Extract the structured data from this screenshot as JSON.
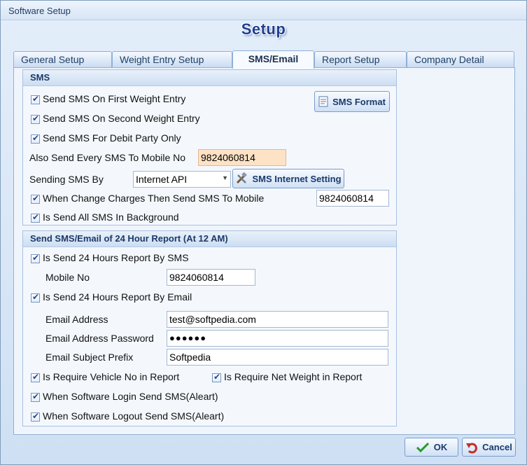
{
  "window": {
    "title": "Software Setup"
  },
  "heading": "Setup",
  "tabs": [
    {
      "label": "General Setup"
    },
    {
      "label": "Weight Entry Setup"
    },
    {
      "label": "SMS/Email"
    },
    {
      "label": "Report Setup"
    },
    {
      "label": "Company Detail"
    }
  ],
  "sms": {
    "header": "SMS",
    "first_entry": "Send SMS On First Weight Entry",
    "second_entry": "Send SMS On Second Weight Entry",
    "debit_party": "Send SMS For Debit Party Only",
    "sms_format_label": "SMS Format",
    "also_send_label": "Also Send Every SMS To Mobile No",
    "also_send_value": "9824060814",
    "sending_by_label": "Sending SMS By",
    "sending_by_value": "Internet API",
    "internet_setting_label": "SMS Internet Setting",
    "change_charges_label": "When Change Charges Then Send SMS To Mobile",
    "change_charges_value": "9824060814",
    "background_label": "Is Send All SMS In Background"
  },
  "report": {
    "header": "Send SMS/Email of 24 Hour Report (At 12 AM)",
    "by_sms_label": "Is Send 24 Hours Report By SMS",
    "mobile_label": "Mobile No",
    "mobile_value": "9824060814",
    "by_email_label": "Is Send 24 Hours Report By Email",
    "email_label": "Email Address",
    "email_value": "test@softpedia.com",
    "password_label": "Email Address Password",
    "password_value": "●●●●●●",
    "subject_label": "Email Subject Prefix",
    "subject_value": "Softpedia",
    "vehicle_label": "Is Require Vehicle No in Report",
    "net_weight_label": "Is Require Net Weight in Report",
    "login_label": "When Software Login Send SMS(Aleart)",
    "logout_label": "When Software Logout Send SMS(Aleart)"
  },
  "footer": {
    "ok_label": "OK",
    "cancel_label": "Cancel"
  },
  "colors": {
    "accent": "#1e3f8f",
    "peach_field": "#fde2c6"
  }
}
